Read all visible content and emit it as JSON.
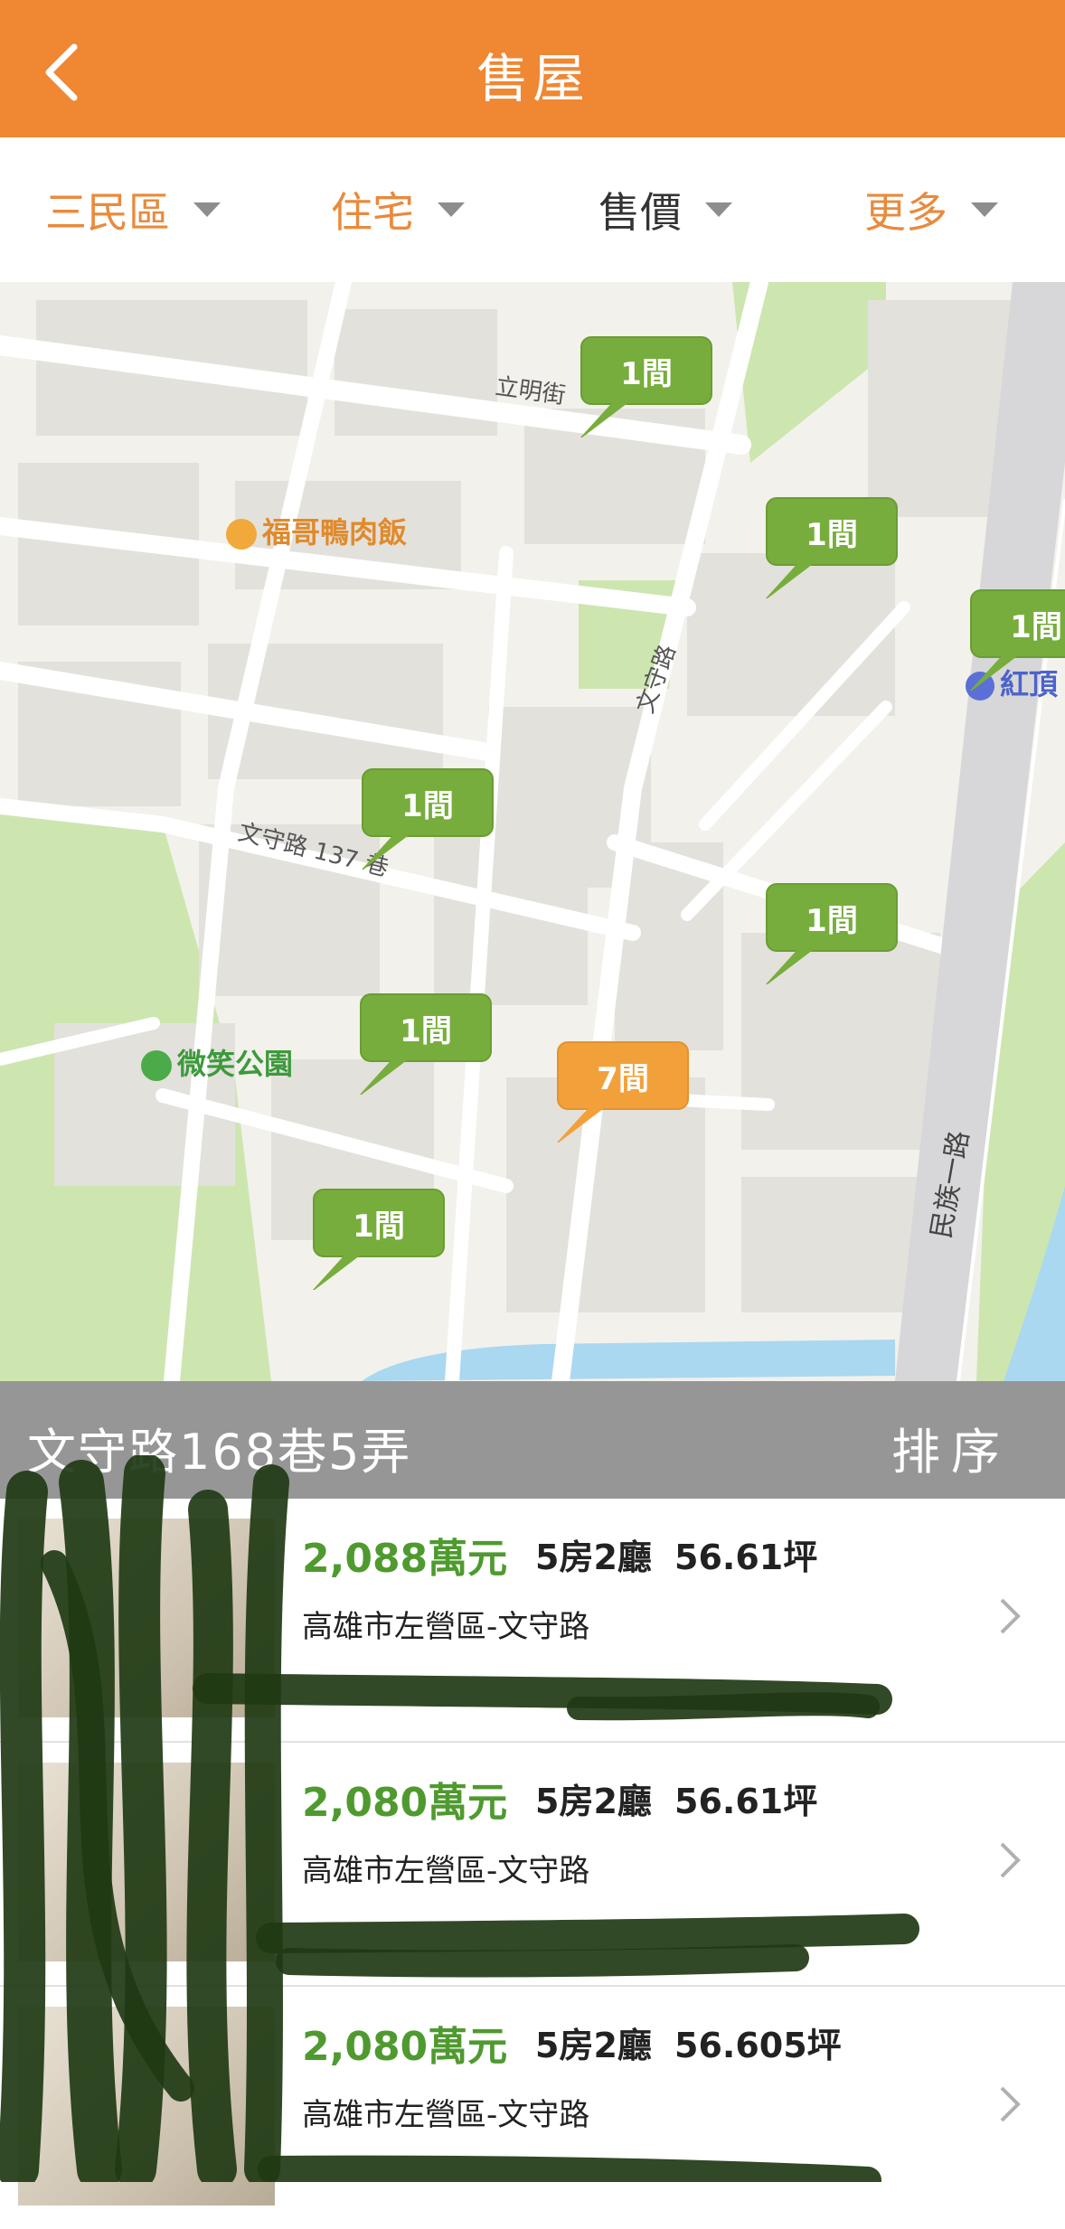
{
  "header": {
    "title": "售屋",
    "back_icon": "chevron-left-icon"
  },
  "filters": [
    {
      "label": "三民區",
      "active": true
    },
    {
      "label": "住宅",
      "active": true
    },
    {
      "label": "售價",
      "active": false
    },
    {
      "label": "更多",
      "active": true
    }
  ],
  "map": {
    "pins": [
      {
        "label": "1間",
        "color": "green"
      },
      {
        "label": "1間",
        "color": "green"
      },
      {
        "label": "1間",
        "color": "green"
      },
      {
        "label": "1間",
        "color": "green"
      },
      {
        "label": "1間",
        "color": "green"
      },
      {
        "label": "1間",
        "color": "green"
      },
      {
        "label": "7間",
        "color": "orange"
      },
      {
        "label": "1間",
        "color": "green"
      }
    ],
    "pois": {
      "restaurant": "福哥鴨肉飯",
      "park": "微笑公園",
      "station": "紅頂"
    },
    "streets": {
      "liming": "立明街",
      "wenshou": "文守路",
      "wenshou_lane": "文守路 137 巷",
      "minzu": "民族一路"
    }
  },
  "address_bar": {
    "address": "文守路168巷5弄",
    "sort_label": "排序"
  },
  "listings": [
    {
      "price": "2,088萬元",
      "rooms": "5房2廳",
      "area": "56.61坪",
      "location": "高雄市左營區-文守路"
    },
    {
      "price": "2,080萬元",
      "rooms": "5房2廳",
      "area": "56.61坪",
      "location": "高雄市左營區-文守路"
    },
    {
      "price": "2,080萬元",
      "rooms": "5房2廳",
      "area": "56.605坪",
      "location": "高雄市左營區-文守路"
    }
  ],
  "colors": {
    "header": "#ef8733",
    "pin_green": "#77ad3c",
    "pin_orange": "#f2a13a",
    "price_green": "#4f9a2f",
    "address_bar": "#969696"
  }
}
